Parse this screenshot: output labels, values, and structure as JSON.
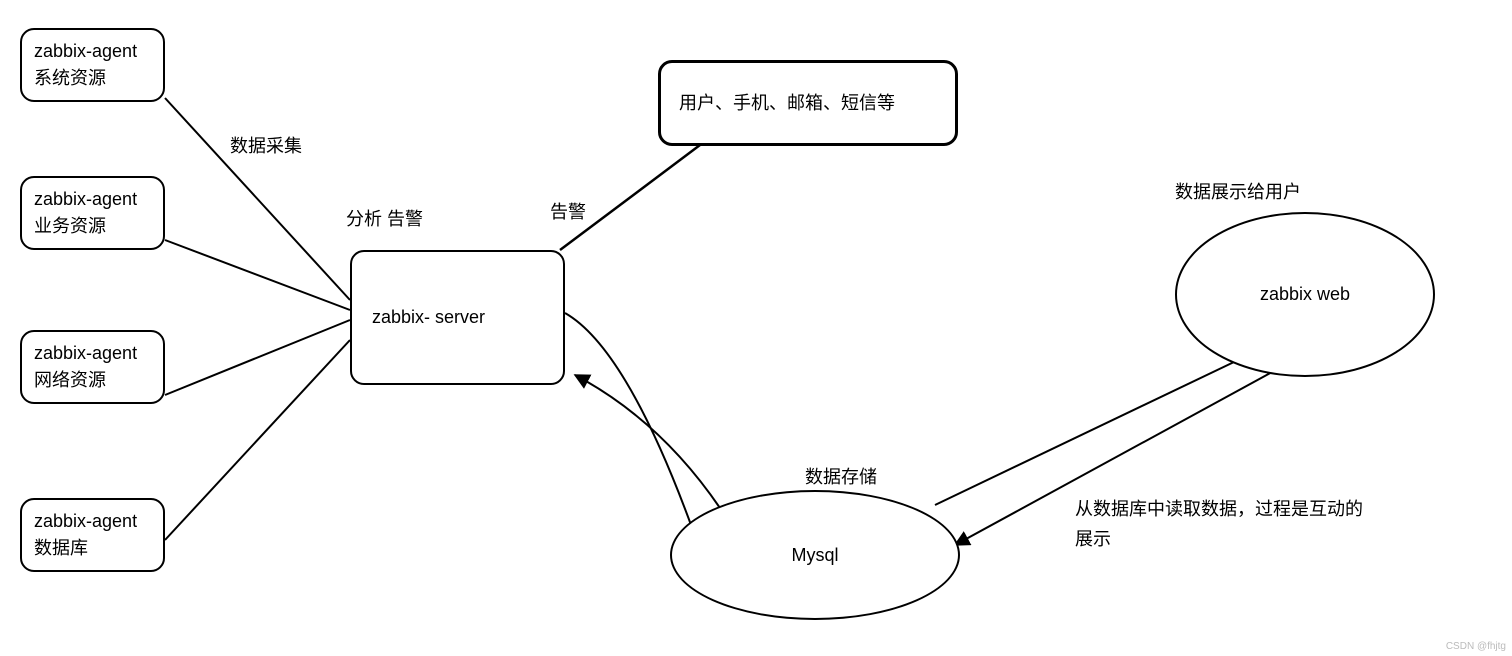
{
  "agents": [
    {
      "line1": "zabbix-agent",
      "line2": "系统资源"
    },
    {
      "line1": "zabbix-agent",
      "line2": "业务资源"
    },
    {
      "line1": "zabbix-agent",
      "line2": "网络资源"
    },
    {
      "line1": "zabbix-agent",
      "line2": "数据库"
    }
  ],
  "server": {
    "label": "zabbix- server"
  },
  "notify": {
    "label": "用户、手机、邮箱、短信等"
  },
  "mysql": {
    "label": "Mysql"
  },
  "web": {
    "label": "zabbix web"
  },
  "labels": {
    "collect": "数据采集",
    "analyze_alert": "分析  告警",
    "alert": "告警",
    "store": "数据存储",
    "display": "数据展示给用户",
    "read1": "从数据库中读取数据，过程是互动的",
    "read2": "展示"
  },
  "watermark": "CSDN @fhjtg"
}
